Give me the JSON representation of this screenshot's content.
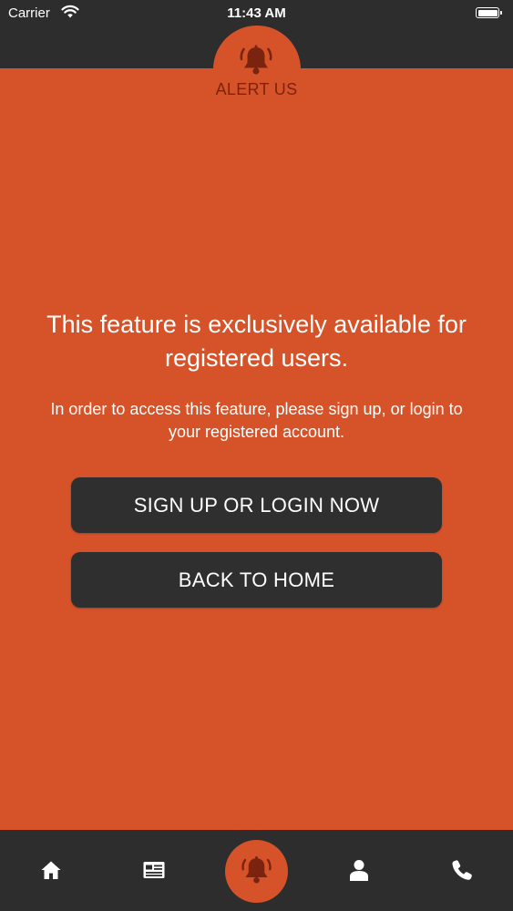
{
  "status_bar": {
    "carrier": "Carrier",
    "time": "11:43 AM"
  },
  "header": {
    "title": "ALERT US",
    "icon": "bell-icon"
  },
  "message": {
    "title": "This feature is exclusively available for registered users.",
    "body": "In order to access this feature, please sign up, or login to your registered account."
  },
  "actions": {
    "signup_label": "SIGN UP OR LOGIN NOW",
    "home_label": "BACK TO HOME"
  },
  "tab_bar": {
    "items": [
      {
        "icon": "home-icon"
      },
      {
        "icon": "news-icon"
      },
      {
        "icon": "bell-icon"
      },
      {
        "icon": "user-icon"
      },
      {
        "icon": "phone-icon"
      }
    ]
  },
  "colors": {
    "accent": "#d6532a",
    "bar": "#2d2d2d",
    "button": "#2f2f2f",
    "header_text": "#7a2410",
    "text": "#ffffff"
  }
}
